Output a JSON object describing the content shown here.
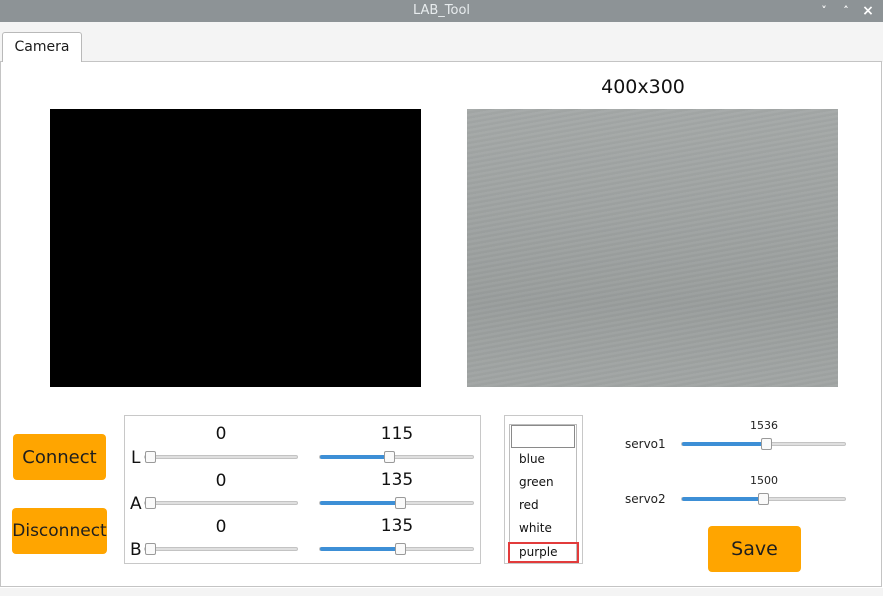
{
  "window": {
    "title": "LAB_Tool",
    "controls": [
      "˅",
      "˄",
      "×"
    ]
  },
  "tabs": [
    {
      "label": "Camera",
      "active": true
    }
  ],
  "camera": {
    "resolution_label": "400x300"
  },
  "buttons": {
    "connect": "Connect",
    "disconnect": "Disconnect",
    "save": "Save"
  },
  "lab": {
    "channels": [
      {
        "name": "L",
        "min": 0,
        "max": 115
      },
      {
        "name": "A",
        "min": 0,
        "max": 135
      },
      {
        "name": "B",
        "min": 0,
        "max": 135
      }
    ],
    "slider_range": [
      0,
      255
    ]
  },
  "color_dropdown": {
    "value": "",
    "options": [
      "blue",
      "green",
      "red",
      "white",
      "purple"
    ],
    "highlighted": "purple"
  },
  "servos": [
    {
      "label": "servo1",
      "value": 1536
    },
    {
      "label": "servo2",
      "value": 1500
    }
  ],
  "servo_range": [
    500,
    2500
  ],
  "colors": {
    "accent": "#ffa500",
    "slider_fill": "#3d8fd6",
    "titlebar": "#8d9396",
    "highlight_border": "#e23b3b"
  }
}
